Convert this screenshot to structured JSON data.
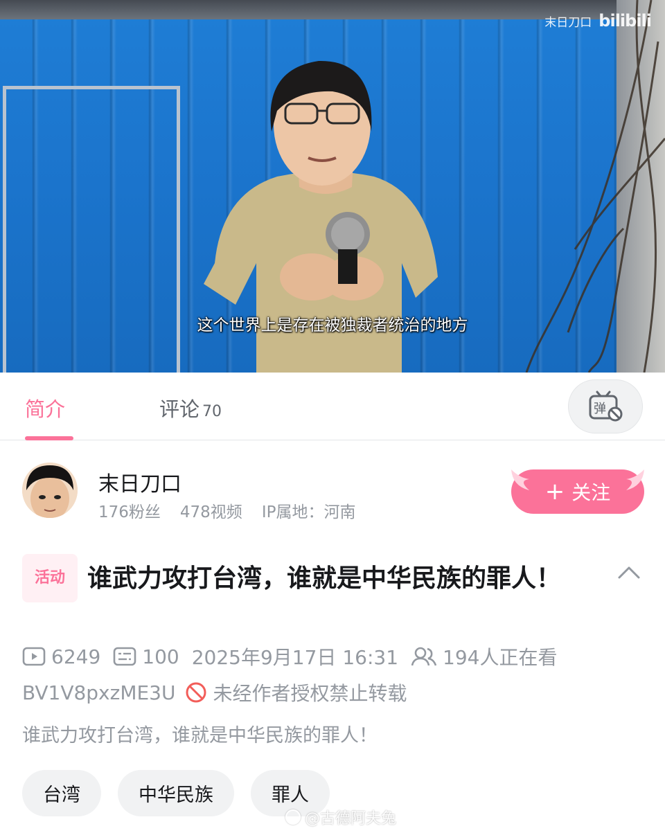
{
  "video": {
    "watermark_channel": "末日刀口",
    "watermark_logo": "bilibili",
    "subtitle": "这个世界上是存在被独裁者统治的地方"
  },
  "tabs": {
    "intro_label": "简介",
    "comments_label": "评论",
    "comments_count": "70",
    "danmaku_icon": "danmaku-toggle-icon"
  },
  "uploader": {
    "name": "末日刀口",
    "fans": "176粉丝",
    "videos": "478视频",
    "ip_location": "IP属地：河南",
    "follow_label": "关注",
    "follow_icon": "+"
  },
  "video_info": {
    "badge": "活动",
    "title": "谁武力攻打台湾，谁就是中华民族的罪人！",
    "plays": "6249",
    "danmaku_count": "100",
    "publish_time": "2025年9月17日 16:31",
    "watching_now": "194人正在看",
    "bvid": "BV1V8pxzME3U",
    "reprint_notice": "未经作者授权禁止转载",
    "description": "谁武力攻打台湾，谁就是中华民族的罪人！",
    "tags": [
      "台湾",
      "中华民族",
      "罪人"
    ]
  },
  "weibo_watermark": "@古德阿夫兔",
  "colors": {
    "accent": "#fb7299",
    "secondary_text": "#9499a0",
    "primary_text": "#18191c",
    "tag_bg": "#f1f2f3"
  }
}
